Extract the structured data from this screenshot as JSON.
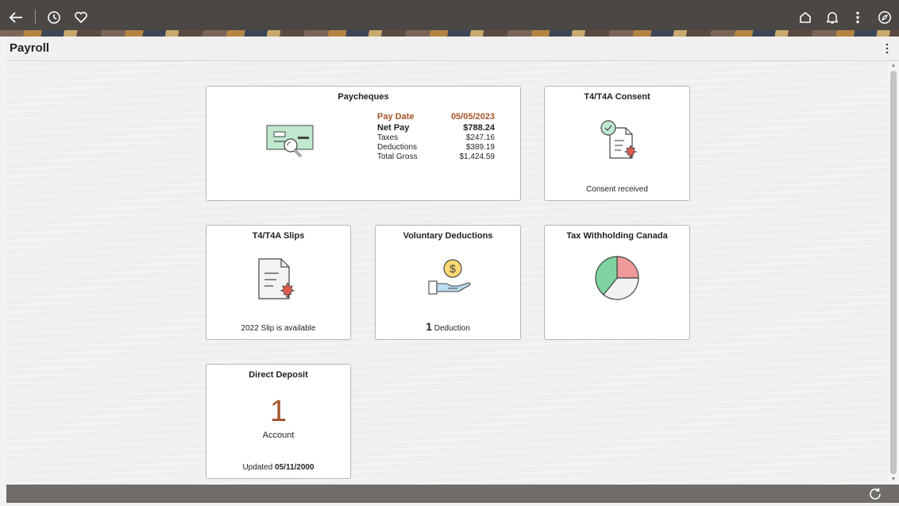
{
  "header": {
    "icons": [
      "back-arrow-icon",
      "history-clock-icon",
      "favorites-heart-icon",
      "home-icon",
      "notifications-bell-icon",
      "actions-kebab-icon",
      "navigator-compass-icon"
    ]
  },
  "page": {
    "title": "Payroll"
  },
  "tiles": {
    "paycheques": {
      "title": "Paycheques",
      "pay_date_label": "Pay Date",
      "pay_date": "05/05/2023",
      "net_pay_label": "Net Pay",
      "net_pay": "$788.24",
      "taxes_label": "Taxes",
      "taxes": "$247.16",
      "deductions_label": "Deductions",
      "deductions": "$389.19",
      "total_gross_label": "Total Gross",
      "total_gross": "$1,424.59"
    },
    "consent": {
      "title": "T4/T4A Consent",
      "status": "Consent received"
    },
    "slips": {
      "title": "T4/T4A Slips",
      "status": "2022 Slip is available"
    },
    "voluntary": {
      "title": "Voluntary Deductions",
      "count": "1",
      "count_label": "Deduction"
    },
    "tax_withholding": {
      "title": "Tax Withholding Canada"
    },
    "direct_deposit": {
      "title": "Direct Deposit",
      "count": "1",
      "count_label": "Account",
      "updated_label": "Updated",
      "updated_date": "05/11/2000"
    }
  },
  "colors": {
    "accent": "#a4542a",
    "pie_green": "#7fd3a0",
    "pie_red": "#ef9a9a",
    "pie_gray": "#f2f2f2"
  }
}
